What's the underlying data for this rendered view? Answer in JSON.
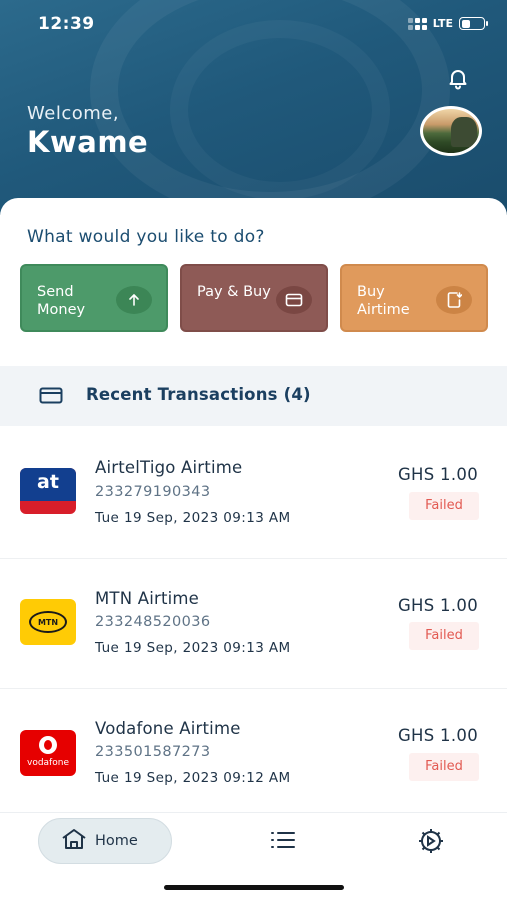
{
  "status_bar": {
    "time": "12:39",
    "network": "LTE",
    "battery_level": 0.4
  },
  "header": {
    "greeting": "Welcome,",
    "user_name": "Kwame",
    "bell_icon": "bell-icon",
    "avatar": "profile-avatar"
  },
  "actions": {
    "prompt": "What would you like to do?",
    "items": [
      {
        "label": "Send Money",
        "icon": "arrow-up-icon",
        "color": "#4d9a6a"
      },
      {
        "label": "Pay & Buy",
        "icon": "card-icon",
        "color": "#8e5a56"
      },
      {
        "label": "Buy Airtime",
        "icon": "airtime-icon",
        "color": "#e09a5c"
      }
    ]
  },
  "recent": {
    "title": "Recent Transactions (4)",
    "icon": "card-icon"
  },
  "transactions": [
    {
      "name": "AirtelTigo Airtime",
      "number": "233279190343",
      "date": "Tue 19 Sep, 2023 09:13 AM",
      "amount": "GHS 1.00",
      "status": "Failed",
      "logo_text": "at"
    },
    {
      "name": "MTN Airtime",
      "number": "233248520036",
      "date": "Tue 19 Sep, 2023 09:13 AM",
      "amount": "GHS 1.00",
      "status": "Failed",
      "logo_text": "MTN"
    },
    {
      "name": "Vodafone Airtime",
      "number": "233501587273",
      "date": "Tue 19 Sep, 2023 09:12 AM",
      "amount": "GHS 1.00",
      "status": "Failed",
      "logo_text": "vodafone"
    }
  ],
  "bottom_nav": {
    "home_label": "Home",
    "items": [
      "home-icon",
      "list-icon",
      "settings-icon"
    ]
  },
  "colors": {
    "header": "#20597b",
    "primary_text": "#1c4d70",
    "failed": "#e25a52"
  }
}
